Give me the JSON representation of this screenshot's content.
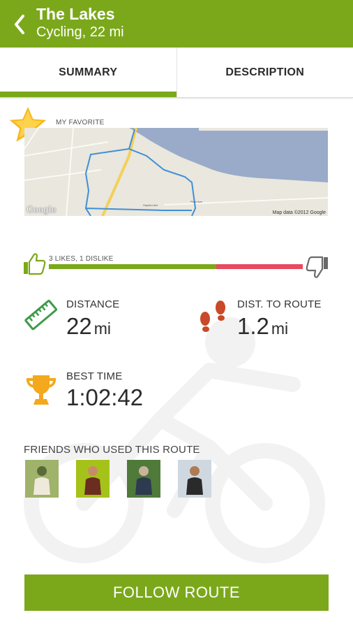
{
  "header": {
    "back_icon": "chevron-left-icon",
    "title": "The Lakes",
    "subtitle": "Cycling, 22 mi",
    "color": "#7ba81b"
  },
  "tabs": [
    {
      "label": "SUMMARY",
      "active": true
    },
    {
      "label": "DESCRIPTION",
      "active": false
    }
  ],
  "favorite": {
    "icon": "star-icon",
    "label": "MY FAVORITE"
  },
  "map": {
    "logo": "Google",
    "attribution": "Map data ©2012 Google"
  },
  "rating": {
    "label": "3 LIKES, 1 DISLIKE",
    "likes": 3,
    "dislikes": 1,
    "like_fraction": 0.66,
    "like_color": "#7ba81b",
    "dislike_color": "#e84a5f",
    "like_icon": "thumbs-up-icon",
    "dislike_icon": "thumbs-down-icon"
  },
  "stats": {
    "distance": {
      "label": "DISTANCE",
      "value": "22",
      "unit": "mi",
      "icon": "ruler-icon"
    },
    "dist_to_route": {
      "label": "DIST. TO ROUTE",
      "value": "1.2",
      "unit": "mi",
      "icon": "footprints-icon"
    },
    "best_time": {
      "label": "BEST TIME",
      "value": "1:02:42",
      "icon": "trophy-icon"
    }
  },
  "friends": {
    "label": "FRIENDS WHO USED THIS ROUTE",
    "items": [
      {
        "name": "friend-1",
        "palette": [
          "#9fb36a",
          "#efe9dc",
          "#5b6a3a"
        ]
      },
      {
        "name": "friend-2",
        "palette": [
          "#a5c21a",
          "#6a2d1f",
          "#c98a6a"
        ]
      },
      {
        "name": "friend-3",
        "palette": [
          "#4f7a3a",
          "#2d3a4f",
          "#c8b49a"
        ]
      },
      {
        "name": "friend-4",
        "palette": [
          "#cfd8e0",
          "#2a2a2a",
          "#b07a52"
        ]
      }
    ]
  },
  "actions": {
    "follow_label": "FOLLOW ROUTE"
  }
}
